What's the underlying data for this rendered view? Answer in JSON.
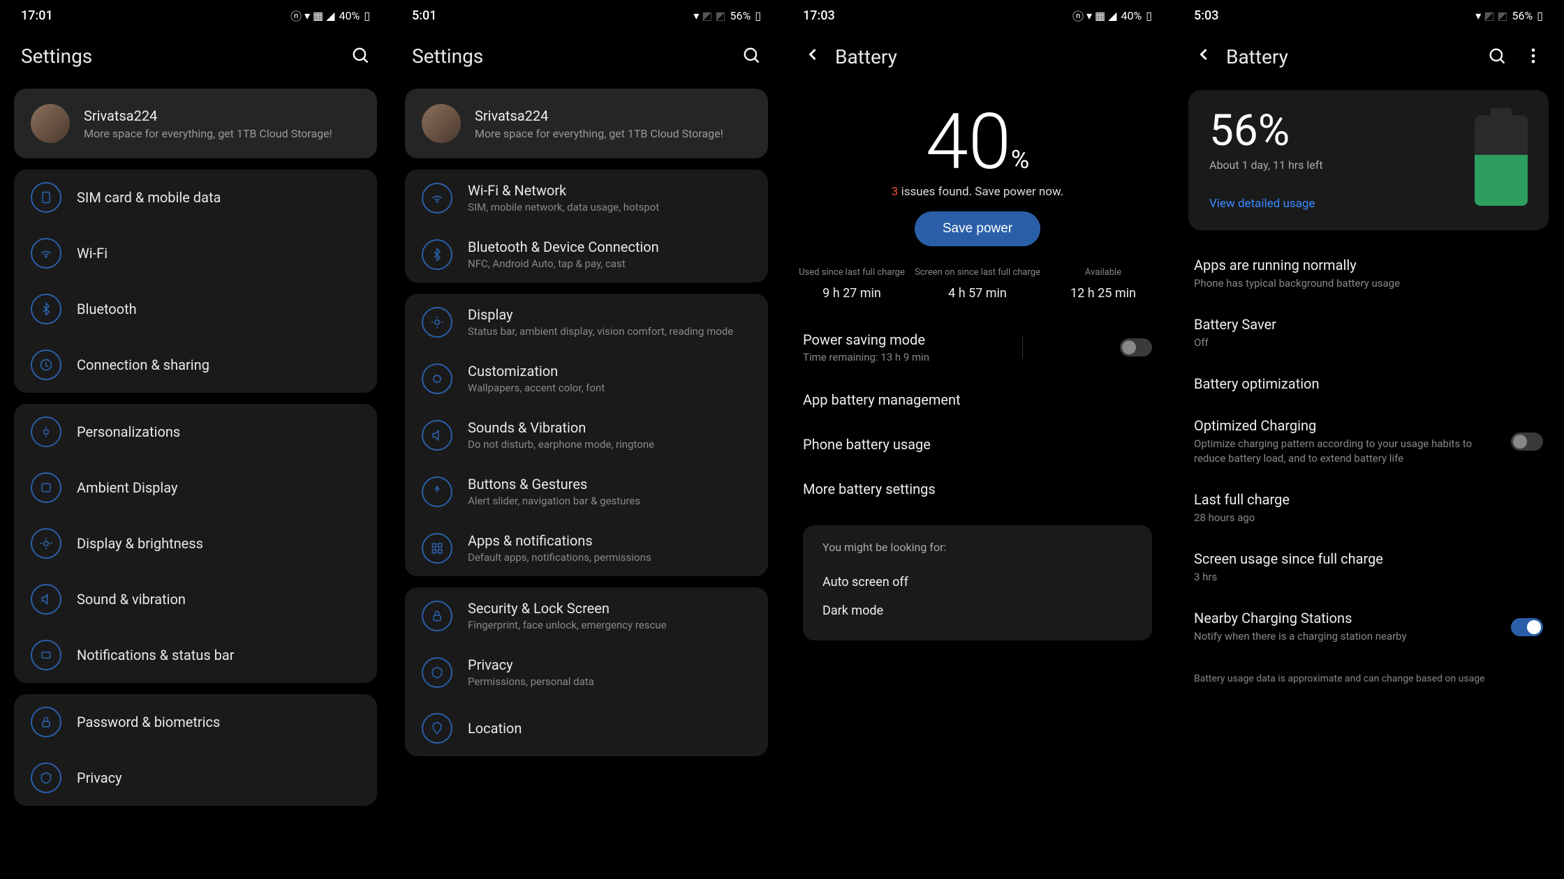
{
  "s1": {
    "time": "17:01",
    "battery": "40%",
    "title": "Settings",
    "user": {
      "name": "Srivatsa224",
      "sub": "More space for everything, get 1TB Cloud Storage!"
    },
    "g1": [
      {
        "t": "SIM card & mobile data"
      },
      {
        "t": "Wi-Fi"
      },
      {
        "t": "Bluetooth"
      },
      {
        "t": "Connection & sharing"
      }
    ],
    "g2": [
      {
        "t": "Personalizations"
      },
      {
        "t": "Ambient Display"
      },
      {
        "t": "Display & brightness"
      },
      {
        "t": "Sound & vibration"
      },
      {
        "t": "Notifications & status bar"
      }
    ],
    "g3": [
      {
        "t": "Password & biometrics"
      },
      {
        "t": "Privacy"
      }
    ]
  },
  "s2": {
    "time": "5:01",
    "battery": "56%",
    "title": "Settings",
    "user": {
      "name": "Srivatsa224",
      "sub": "More space for everything, get 1TB Cloud Storage!"
    },
    "g1": [
      {
        "t": "Wi-Fi & Network",
        "s": "SIM, mobile network, data usage, hotspot"
      },
      {
        "t": "Bluetooth & Device Connection",
        "s": "NFC, Android Auto, tap & pay, cast"
      }
    ],
    "g2": [
      {
        "t": "Display",
        "s": "Status bar, ambient display, vision comfort, reading mode"
      },
      {
        "t": "Customization",
        "s": "Wallpapers, accent color, font"
      },
      {
        "t": "Sounds & Vibration",
        "s": "Do not disturb, earphone mode, ringtone"
      },
      {
        "t": "Buttons & Gestures",
        "s": "Alert slider, navigation bar & gestures"
      },
      {
        "t": "Apps & notifications",
        "s": "Default apps, notifications, permissions"
      }
    ],
    "g3": [
      {
        "t": "Security & Lock Screen",
        "s": "Fingerprint, face unlock, emergency rescue"
      },
      {
        "t": "Privacy",
        "s": "Permissions, personal data"
      },
      {
        "t": "Location",
        "s": ""
      }
    ]
  },
  "s3": {
    "time": "17:03",
    "battery": "40%",
    "title": "Battery",
    "pct": "40",
    "pct_sym": "%",
    "issues_n": "3",
    "issues_txt": " issues found. Save power now.",
    "save_btn": "Save power",
    "stats": {
      "l1": "Used since last full charge",
      "v1": "9 h 27 min",
      "l2": "Screen on since last full charge",
      "v2": "4 h 57 min",
      "l3": "Available",
      "v3": "12 h 25 min"
    },
    "psm": {
      "t": "Power saving mode",
      "s": "Time remaining:  13 h 9 min"
    },
    "items": [
      "App battery management",
      "Phone battery usage",
      "More battery settings"
    ],
    "hint_header": "You might be looking for:",
    "hints": [
      "Auto screen off",
      "Dark mode"
    ]
  },
  "s4": {
    "time": "5:03",
    "battery": "56%",
    "title": "Battery",
    "pct": "56%",
    "time_left": "About 1 day, 11 hrs left",
    "link": "View detailed usage",
    "apps_normal": {
      "t": "Apps are running normally",
      "s": "Phone has typical background battery usage"
    },
    "saver": {
      "t": "Battery Saver",
      "s": "Off"
    },
    "opt": "Battery optimization",
    "optcharge": {
      "t": "Optimized Charging",
      "s": "Optimize charging pattern according to your usage habits to reduce battery load, and to extend battery life"
    },
    "lastfull": {
      "t": "Last full charge",
      "s": "28 hours ago"
    },
    "screenuse": {
      "t": "Screen usage since full charge",
      "s": "3 hrs"
    },
    "nearby": {
      "t": "Nearby Charging Stations",
      "s": "Notify when there is a charging station nearby"
    },
    "footer": "Battery usage data is approximate and can change based on usage"
  }
}
